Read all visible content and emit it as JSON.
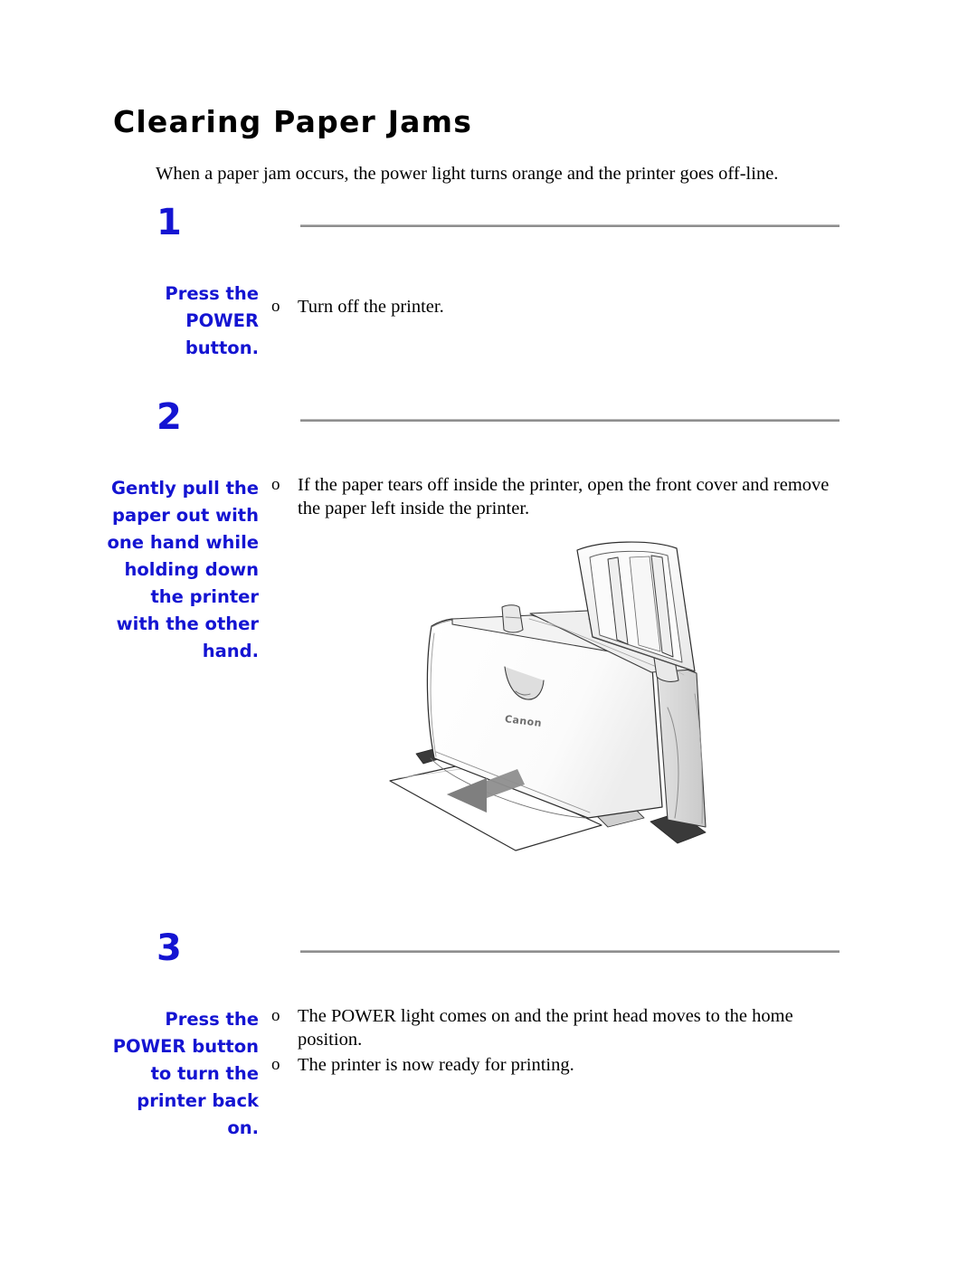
{
  "document": {
    "title": "Clearing Paper Jams",
    "intro": "When a paper jam occurs, the power light turns orange and the printer goes off-line."
  },
  "colors": {
    "accent_blue": "#1414D2",
    "rule_gray": "#8e8e8e",
    "text_black": "#000000",
    "illustration_gray": "#8a8a8a"
  },
  "steps": [
    {
      "number": "1",
      "label": "Press the POWER button.",
      "bullet_marker": "o",
      "bullets": [
        "Turn off the printer."
      ]
    },
    {
      "number": "2",
      "label": "Gently pull the paper out with one hand while holding down the printer with the other hand.",
      "bullet_marker": "o",
      "bullets": [
        "If the paper tears off inside the printer, open the front cover and remove the paper left inside the printer."
      ],
      "figure": {
        "name": "printer-paper-jam-illustration",
        "brand_logo": "Canon",
        "caption": ""
      }
    },
    {
      "number": "3",
      "label": "Press the POWER button to turn the printer back on.",
      "bullet_marker": "o",
      "bullets": [
        "The POWER light comes on and the print head moves to the home position.",
        "The printer is now ready for printing."
      ]
    }
  ]
}
